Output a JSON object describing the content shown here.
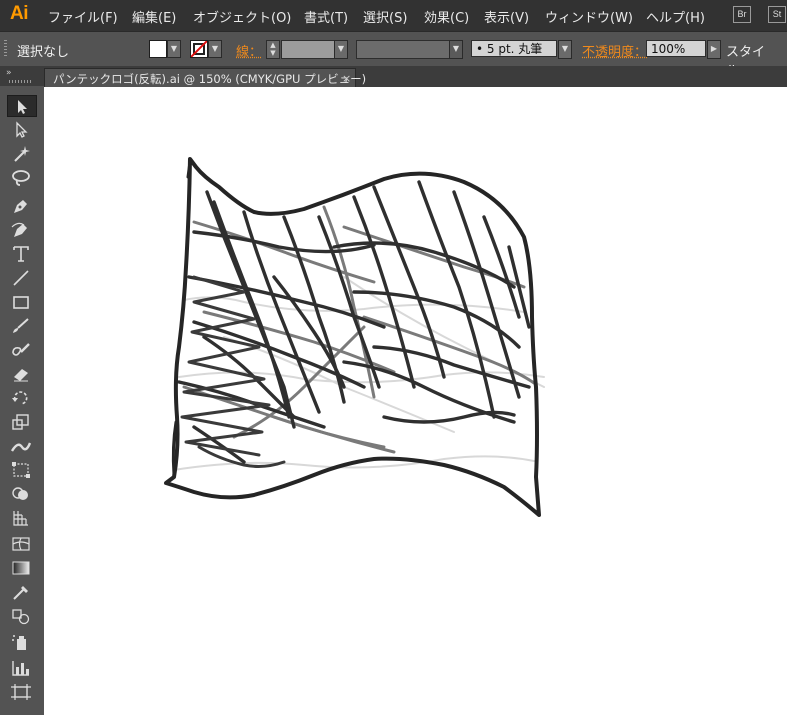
{
  "app": {
    "logo": "Ai"
  },
  "menu": [
    "ファイル(F)",
    "編集(E)",
    "オブジェクト(O)",
    "書式(T)",
    "選択(S)",
    "効果(C)",
    "表示(V)",
    "ウィンドウ(W)",
    "ヘルプ(H)"
  ],
  "app_buttons": [
    "Br",
    "St"
  ],
  "control": {
    "selection_status": "選択なし",
    "stroke_label": "線：",
    "brush_value": "•  5 pt. 丸筆",
    "opacity_label": "不透明度：",
    "opacity_value": "100%",
    "style_label": "スタイル："
  },
  "document": {
    "tab_title": "パンテックロゴ(反転).ai @ 150% (CMYK/GPU プレビュー)",
    "close_glyph": "×"
  },
  "colors": {
    "accent_orange": "#ff9a00",
    "menubar_bg": "#323232",
    "panel_bg": "#535353",
    "canvas_bg": "#ffffff"
  },
  "tools": [
    "selection-tool-icon",
    "direct-selection-tool-icon",
    "magic-wand-tool-icon",
    "lasso-tool-icon",
    "pen-tool-icon",
    "curvature-tool-icon",
    "type-tool-icon",
    "line-segment-tool-icon",
    "rectangle-tool-icon",
    "paintbrush-tool-icon",
    "shaper-tool-icon",
    "eraser-tool-icon",
    "rotate-tool-icon",
    "scale-tool-icon",
    "width-tool-icon",
    "free-transform-tool-icon",
    "shape-builder-tool-icon",
    "perspective-grid-tool-icon",
    "mesh-tool-icon",
    "gradient-tool-icon",
    "eyedropper-tool-icon",
    "blend-tool-icon",
    "symbol-sprayer-tool-icon",
    "column-graph-tool-icon",
    "artboard-tool-icon"
  ]
}
